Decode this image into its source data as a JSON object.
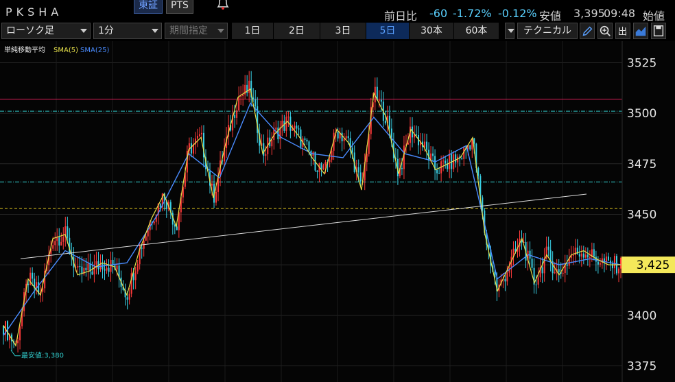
{
  "header": {
    "stock_code": "PKSHA",
    "exchange_tabs": [
      "東証",
      "PTS"
    ],
    "active_exchange": "東証",
    "prev_day_label": "前日比",
    "change": "-60",
    "change_pct": "-1.72%",
    "change_pct2": "-0.12%",
    "low_label": "安値",
    "low_value": "3,395",
    "time": "09:48",
    "open_label": "始値"
  },
  "toolbar": {
    "chart_type": "ローソク足",
    "interval": "1分",
    "period_select": "期間指定",
    "ranges": [
      "1日",
      "2日",
      "3日",
      "5日",
      "30本",
      "60本"
    ],
    "active_range": "5日",
    "technical_label": "テクニカル",
    "icons": [
      "pencil-icon",
      "zoom-icon",
      "output-icon",
      "area-chart-icon",
      "save-icon"
    ]
  },
  "colors": {
    "sma5": "#e6e04a",
    "sma25": "#4a8cff",
    "up_candle": "#ff3a3a",
    "down_candle": "#3ad1e6",
    "trendline": "#dddddd",
    "resistance_line": "#e0205a",
    "dotted_teal": "#30c8c8",
    "dashed_yellow": "#e8d020",
    "price_tag_bg": "#f4e85a"
  },
  "chart_data": {
    "type": "line",
    "indicator_title": "単純移動平均",
    "legend": [
      {
        "name": "SMA(5)",
        "color": "#e6e04a"
      },
      {
        "name": "SMA(25)",
        "color": "#4a8cff"
      }
    ],
    "y_ticks": [
      3525,
      3500,
      3475,
      3450,
      3425,
      3400,
      3375
    ],
    "ylim": [
      3367,
      3535
    ],
    "current_price": 3425,
    "current_price_label": "3,425",
    "low_annotation": "最安値:3,380",
    "low_price": 3380,
    "h_lines": [
      {
        "y": 3507,
        "style": "solid",
        "color": "#e0205a"
      },
      {
        "y": 3501,
        "style": "dashdot",
        "color": "#30c8c8"
      },
      {
        "y": 3466,
        "style": "dashdot",
        "color": "#30c8c8"
      },
      {
        "y": 3453,
        "style": "dashed",
        "color": "#e8d020"
      }
    ],
    "trendline": {
      "start": [
        0,
        3428
      ],
      "end": [
        1,
        3460
      ]
    },
    "sma5": {
      "x": [
        0,
        0.02,
        0.04,
        0.06,
        0.08,
        0.1,
        0.12,
        0.14,
        0.16,
        0.18,
        0.2,
        0.22,
        0.24,
        0.26,
        0.28,
        0.3,
        0.32,
        0.34,
        0.36,
        0.38,
        0.4,
        0.42,
        0.44,
        0.46,
        0.48,
        0.5,
        0.52,
        0.54,
        0.56,
        0.58,
        0.6,
        0.62,
        0.64,
        0.66,
        0.68,
        0.7,
        0.72,
        0.74,
        0.76,
        0.78,
        0.8,
        0.82,
        0.84,
        0.86,
        0.88,
        0.9,
        0.92,
        0.94,
        0.96,
        0.98,
        1.0
      ],
      "y": [
        3395,
        3385,
        3418,
        3410,
        3438,
        3440,
        3420,
        3422,
        3426,
        3424,
        3410,
        3432,
        3448,
        3460,
        3444,
        3482,
        3488,
        3458,
        3485,
        3508,
        3512,
        3480,
        3490,
        3496,
        3488,
        3478,
        3470,
        3492,
        3485,
        3462,
        3510,
        3498,
        3470,
        3492,
        3484,
        3472,
        3475,
        3478,
        3488,
        3440,
        3412,
        3425,
        3438,
        3416,
        3430,
        3420,
        3430,
        3432,
        3428,
        3425,
        3425
      ]
    },
    "sma25": {
      "x": [
        0,
        0.05,
        0.1,
        0.15,
        0.2,
        0.25,
        0.3,
        0.35,
        0.4,
        0.45,
        0.5,
        0.55,
        0.6,
        0.65,
        0.7,
        0.75,
        0.8,
        0.85,
        0.9,
        0.95,
        1.0
      ],
      "y": [
        3390,
        3412,
        3432,
        3424,
        3426,
        3450,
        3480,
        3468,
        3505,
        3488,
        3480,
        3478,
        3498,
        3480,
        3476,
        3484,
        3418,
        3430,
        3425,
        3428,
        3425
      ]
    }
  }
}
